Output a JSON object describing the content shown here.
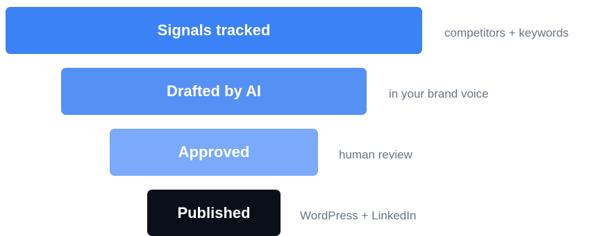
{
  "funnel": {
    "stages": [
      {
        "label": "Signals tracked",
        "note": "competitors + keywords",
        "color": "#3b82f6",
        "text_color": "#ffffff"
      },
      {
        "label": "Drafted by AI",
        "note": "in your brand voice",
        "color": "#5591f5",
        "text_color": "#ffffff"
      },
      {
        "label": "Approved",
        "note": "human review",
        "color": "#7aaaf9",
        "text_color": "#ffffff"
      },
      {
        "label": "Published",
        "note": "WordPress + LinkedIn",
        "color": "#0b0f1a",
        "text_color": "#ffffff"
      }
    ]
  }
}
